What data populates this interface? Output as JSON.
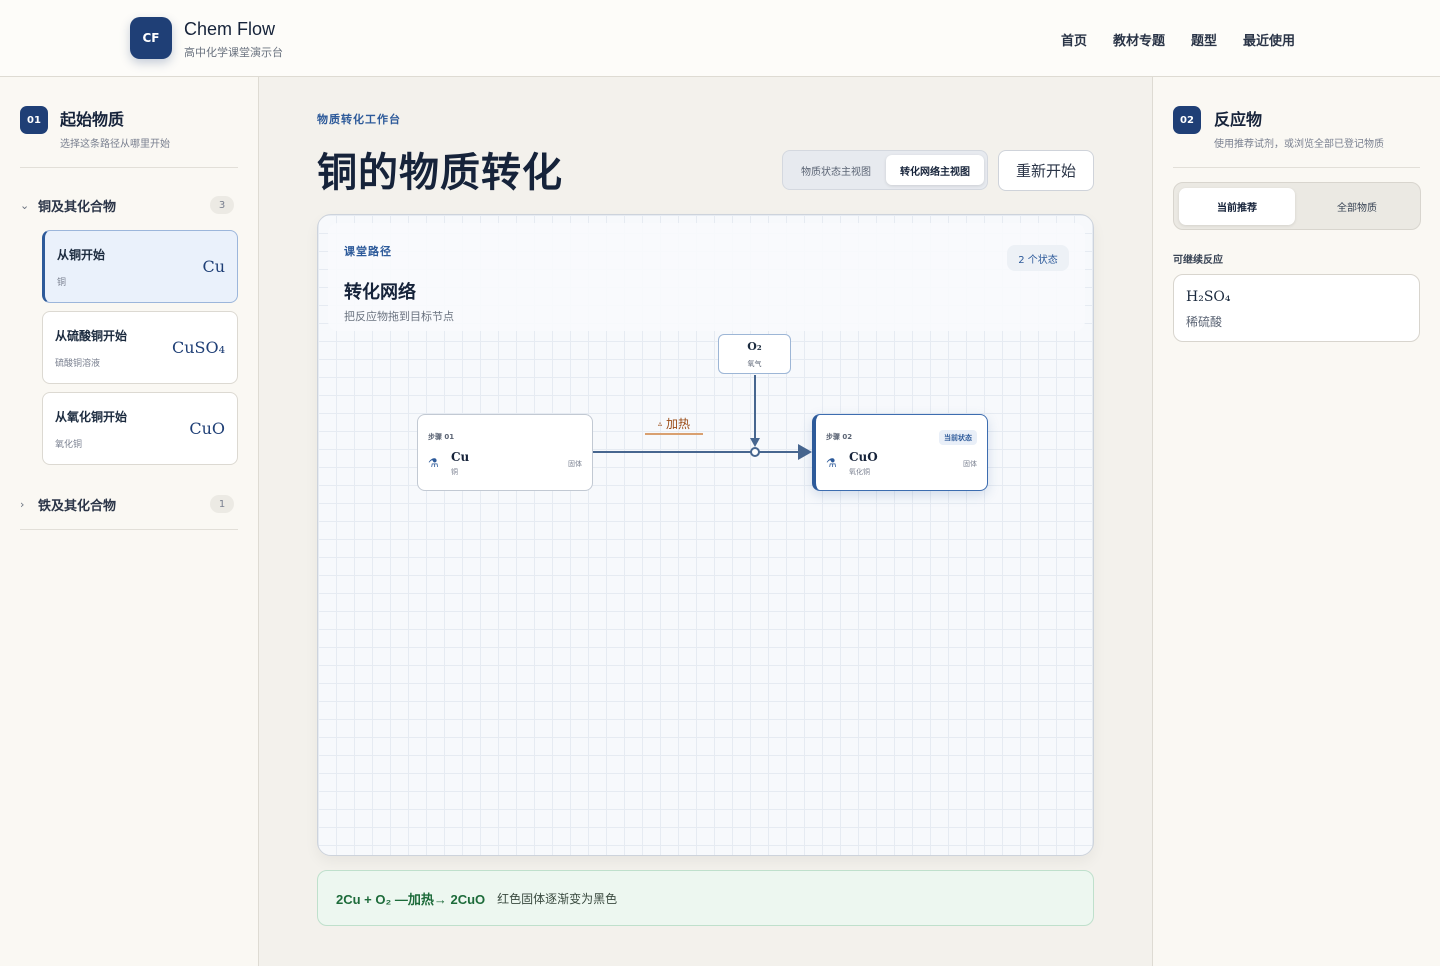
{
  "header": {
    "logo_text": "CF",
    "brand": "Chem Flow",
    "subtitle": "高中化学课堂演示台",
    "nav": [
      "首页",
      "教材专题",
      "题型",
      "最近使用"
    ]
  },
  "left": {
    "badge": "01",
    "title": "起始物质",
    "subtitle": "选择这条路径从哪里开始",
    "groups": [
      {
        "label": "铜及其化合物",
        "count": "3",
        "expanded": true,
        "items": [
          {
            "title": "从铜开始",
            "sub": "铜",
            "formula": "Cu",
            "active": true
          },
          {
            "title": "从硫酸铜开始",
            "sub": "硫酸铜溶液",
            "formula": "CuSO₄",
            "active": false
          },
          {
            "title": "从氧化铜开始",
            "sub": "氧化铜",
            "formula": "CuO",
            "active": false
          }
        ]
      },
      {
        "label": "铁及其化合物",
        "count": "1",
        "expanded": false
      }
    ]
  },
  "main": {
    "eyebrow": "物质转化工作台",
    "title": "铜的物质转化",
    "views": [
      "物质状态主视图",
      "转化网络主视图"
    ],
    "active_view": "转化网络主视图",
    "restart": "重新开始",
    "canvas": {
      "eyebrow": "课堂路径",
      "title": "转化网络",
      "subtitle": "把反应物拖到目标节点",
      "state_count": "2 个状态",
      "nodes": [
        {
          "step": "步骤 01",
          "formula": "Cu",
          "name": "铜",
          "state": "固体",
          "current": false
        },
        {
          "step": "步骤 02",
          "formula": "CuO",
          "name": "氧化铜",
          "state": "固体",
          "current": true,
          "badge": "当前状态"
        }
      ],
      "reagent": {
        "formula": "O₂",
        "name": "氧气"
      },
      "condition": {
        "icon": "flame-icon",
        "glyph": "▵",
        "label": "加热"
      }
    },
    "equation": {
      "text": "2Cu + O₂ —加热→ 2CuO",
      "note": "红色固体逐渐变为黑色"
    }
  },
  "right": {
    "badge": "02",
    "title": "反应物",
    "subtitle": "使用推荐试剂，或浏览全部已登记物质",
    "tabs": [
      "当前推荐",
      "全部物质"
    ],
    "active_tab": "当前推荐",
    "section_label": "可继续反应",
    "reagents": [
      {
        "formula": "H₂SO₄",
        "name": "稀硫酸"
      }
    ]
  },
  "colors": {
    "primary": "#1f3f76",
    "accent": "#2d5a9a",
    "condition": "#9a4a14",
    "equation": "#1d6b3a"
  }
}
